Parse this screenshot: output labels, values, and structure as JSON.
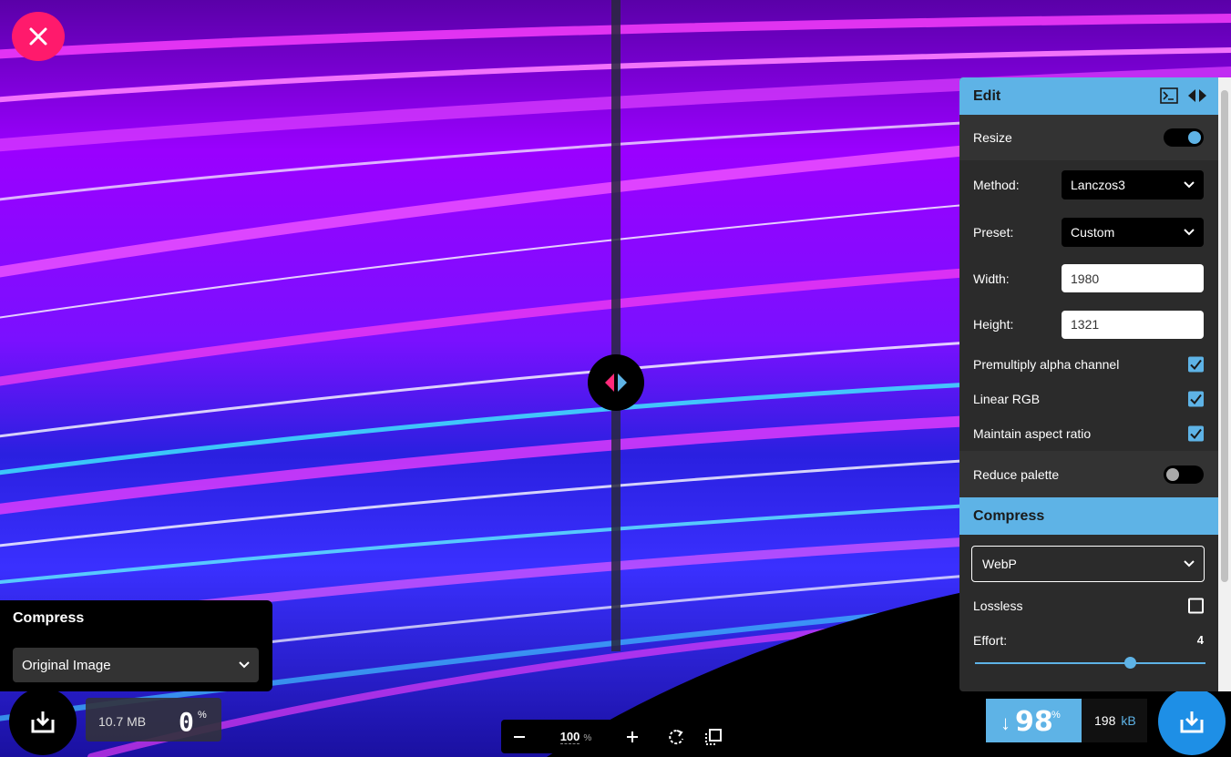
{
  "colors": {
    "accent": "#5eb3e6",
    "close": "#ff1a6c",
    "download_right": "#1e8fe6"
  },
  "left_panel": {
    "title": "Compress",
    "select_value": "Original Image"
  },
  "left_stats": {
    "size": "10.7 MB",
    "percent": "0",
    "percent_symbol": "%"
  },
  "zoom": {
    "value": "100",
    "unit": "%"
  },
  "right_stats": {
    "arrow": "↓",
    "percent": "98",
    "percent_symbol": "%",
    "size": "198",
    "size_unit": "kB"
  },
  "edit_panel": {
    "title": "Edit",
    "resize_label": "Resize",
    "resize_on": true,
    "method_label": "Method:",
    "method_value": "Lanczos3",
    "preset_label": "Preset:",
    "preset_value": "Custom",
    "width_label": "Width:",
    "width_value": "1980",
    "height_label": "Height:",
    "height_value": "1321",
    "premultiply_label": "Premultiply alpha channel",
    "premultiply_checked": true,
    "linear_rgb_label": "Linear RGB",
    "linear_rgb_checked": true,
    "aspect_label": "Maintain aspect ratio",
    "aspect_checked": true,
    "reduce_palette_label": "Reduce palette",
    "reduce_palette_on": false
  },
  "compress_panel": {
    "title": "Compress",
    "format_value": "WebP",
    "lossless_label": "Lossless",
    "lossless_checked": false,
    "effort_label": "Effort:",
    "effort_value": "4",
    "effort_fraction": 0.67
  },
  "icons": {
    "close": "close-icon",
    "download": "download-icon",
    "compare_handle": "compare-arrows-icon",
    "terminal": "terminal-icon",
    "panel_toggle": "collapse-panel-icon",
    "rotate": "rotate-icon",
    "crop": "fit-screen-icon"
  }
}
